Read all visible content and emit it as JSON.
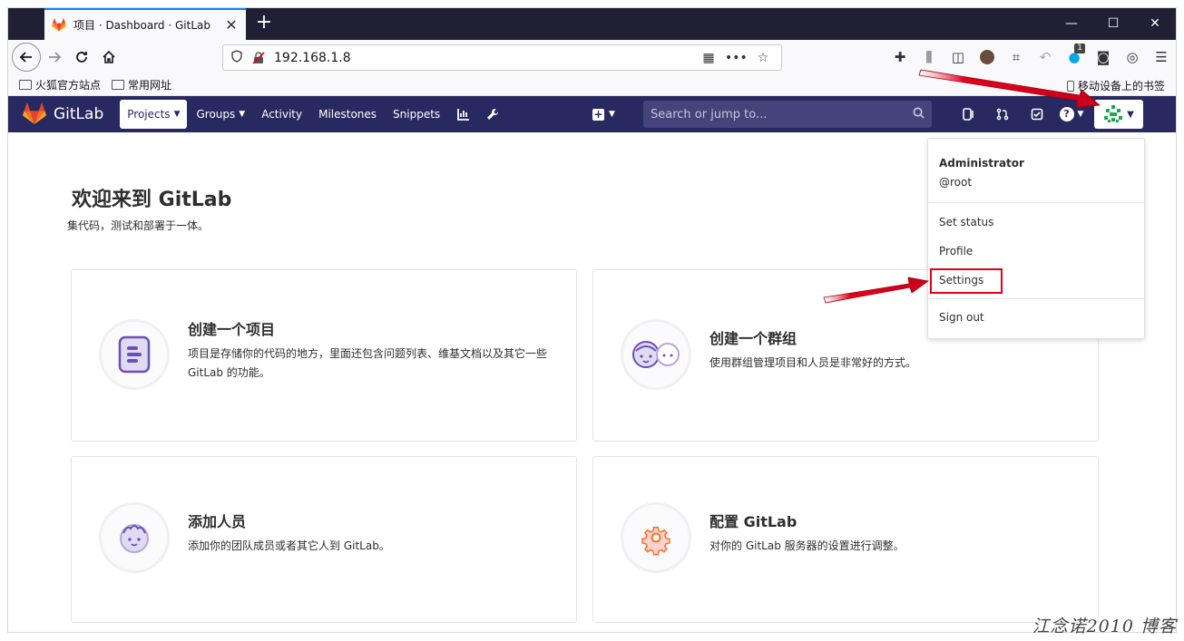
{
  "browser": {
    "tab_title": "项目 · Dashboard · GitLab",
    "url": "192.168.1.8",
    "bookmarks": [
      "火狐官方站点",
      "常用网址"
    ],
    "mobile_bookmarks": "移动设备上的书签",
    "extension_badge": "1"
  },
  "gitlab": {
    "brand": "GitLab",
    "nav": {
      "projects": "Projects",
      "groups": "Groups",
      "activity": "Activity",
      "milestones": "Milestones",
      "snippets": "Snippets"
    },
    "search_placeholder": "Search or jump to..."
  },
  "dropdown": {
    "name": "Administrator",
    "username": "@root",
    "items": {
      "set_status": "Set status",
      "profile": "Profile",
      "settings": "Settings",
      "sign_out": "Sign out"
    }
  },
  "main": {
    "welcome_title": "欢迎来到 GitLab",
    "welcome_subtitle": "集代码，测试和部署于一体。",
    "cards": [
      {
        "title": "创建一个项目",
        "desc": "项目是存储你的代码的地方，里面还包含问题列表、维基文档以及其它一些 GitLab 的功能。"
      },
      {
        "title": "创建一个群组",
        "desc": "使用群组管理项目和人员是非常好的方式。"
      },
      {
        "title": "添加人员",
        "desc": "添加你的团队成员或者其它人到 GitLab。"
      },
      {
        "title": "配置 GitLab",
        "desc": "对你的 GitLab 服务器的设置进行调整。"
      }
    ]
  },
  "watermark": "江念诺2010 博客",
  "colors": {
    "header_bg": "#292961",
    "annotation_red": "#e3001b",
    "gitlab_orange": "#fc6d26"
  }
}
